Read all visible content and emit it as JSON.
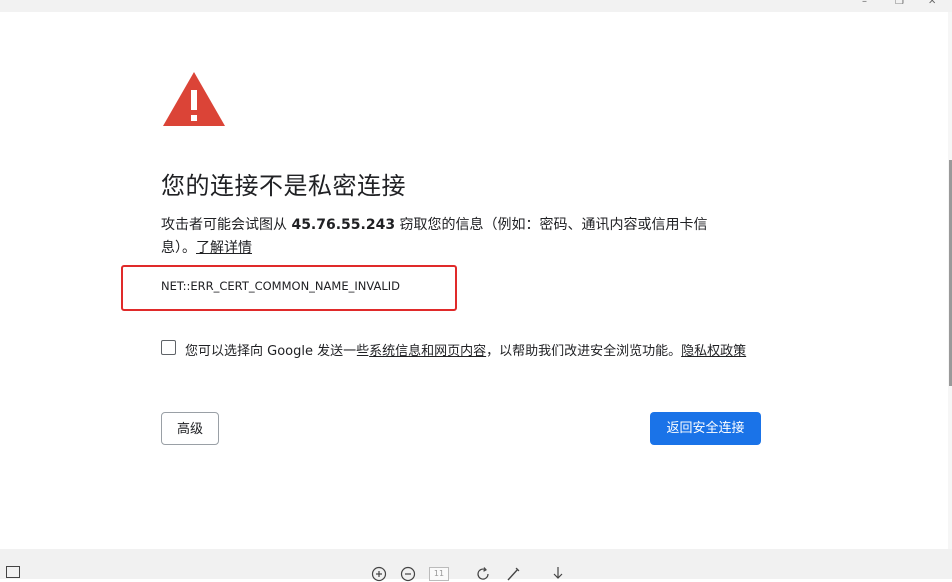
{
  "window": {
    "minimize_glyph": "–",
    "restore_glyph": "❐",
    "close_glyph": "✕"
  },
  "error": {
    "title": "您的连接不是私密连接",
    "desc_prefix": "攻击者可能会试图从 ",
    "host": "45.76.55.243",
    "desc_suffix": " 窃取您的信息（例如：密码、通讯内容或信用卡信息）。",
    "learn_more": "了解详情",
    "code": "NET::ERR_CERT_COMMON_NAME_INVALID"
  },
  "optin": {
    "prefix": "您可以选择向 Google 发送一些",
    "link1": "系统信息和网页内容",
    "middle": "，以帮助我们改进安全浏览功能。",
    "link2": "隐私权政策",
    "checked": false
  },
  "buttons": {
    "advanced": "高级",
    "back_to_safety": "返回安全连接"
  },
  "toolbar": {
    "page_number": "11",
    "icons": [
      "sidebar-icon",
      "zoom-in-icon",
      "zoom-out-icon",
      "page-number-box",
      "rotate-icon",
      "pen-icon",
      "download-icon"
    ]
  },
  "colors": {
    "warning_red": "#db4437",
    "highlight_red": "#e02a2a",
    "primary_blue": "#1a73e8",
    "text": "#202124"
  }
}
